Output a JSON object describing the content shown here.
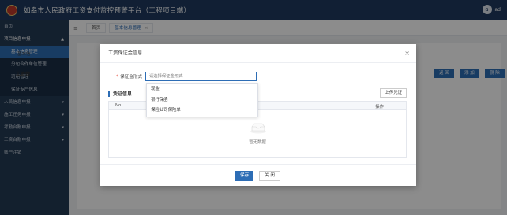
{
  "header": {
    "title": "如皋市人民政府工资支付监控预警平台（工程项目端）",
    "username": "ad",
    "avatar_letter": "a"
  },
  "sidebar": {
    "items": [
      {
        "label": "首页"
      },
      {
        "label": "项目信息申报",
        "caret": "▲"
      },
      {
        "label": "基本信息管理"
      },
      {
        "label": "分包合作单位管理"
      },
      {
        "label": "班组管理"
      },
      {
        "label": "保证专户信息"
      },
      {
        "label": "人员信息申报",
        "caret": "▾"
      },
      {
        "label": "施工任务申报",
        "caret": "▾"
      },
      {
        "label": "考勤台账申报",
        "caret": "▾"
      },
      {
        "label": "工资台账申报",
        "caret": "▾"
      },
      {
        "label": "账户注销"
      }
    ]
  },
  "tabs": {
    "menu_icon": "≡",
    "home": "首页",
    "current": "基本信息管理",
    "close": "×"
  },
  "background": {
    "label1": "基本信",
    "label2": "工资保",
    "btn_back": "返 回",
    "btn_add": "添 加",
    "btn_delete": "删 除",
    "col_no": "序号",
    "col_status": "审核状态",
    "col_op": "操作"
  },
  "modal": {
    "title": "工资保证金信息",
    "close": "×",
    "field": {
      "required_mark": "*",
      "label": "保证金形式",
      "placeholder": "请选择保证金形式"
    },
    "dropdown": {
      "options": [
        "现金",
        "银行保函",
        "保险公司保险单"
      ]
    },
    "section_title": "凭证信息",
    "upload_button": "上传凭证",
    "table": {
      "col_no": "No.",
      "col_op": "操作",
      "empty_text": "暂无数据"
    },
    "footer": {
      "save": "保存",
      "close": "关 闭"
    }
  },
  "colors": {
    "primary": "#2d6db5",
    "header_bg": "#1f3a5f",
    "sidebar_bg": "#243b55"
  }
}
